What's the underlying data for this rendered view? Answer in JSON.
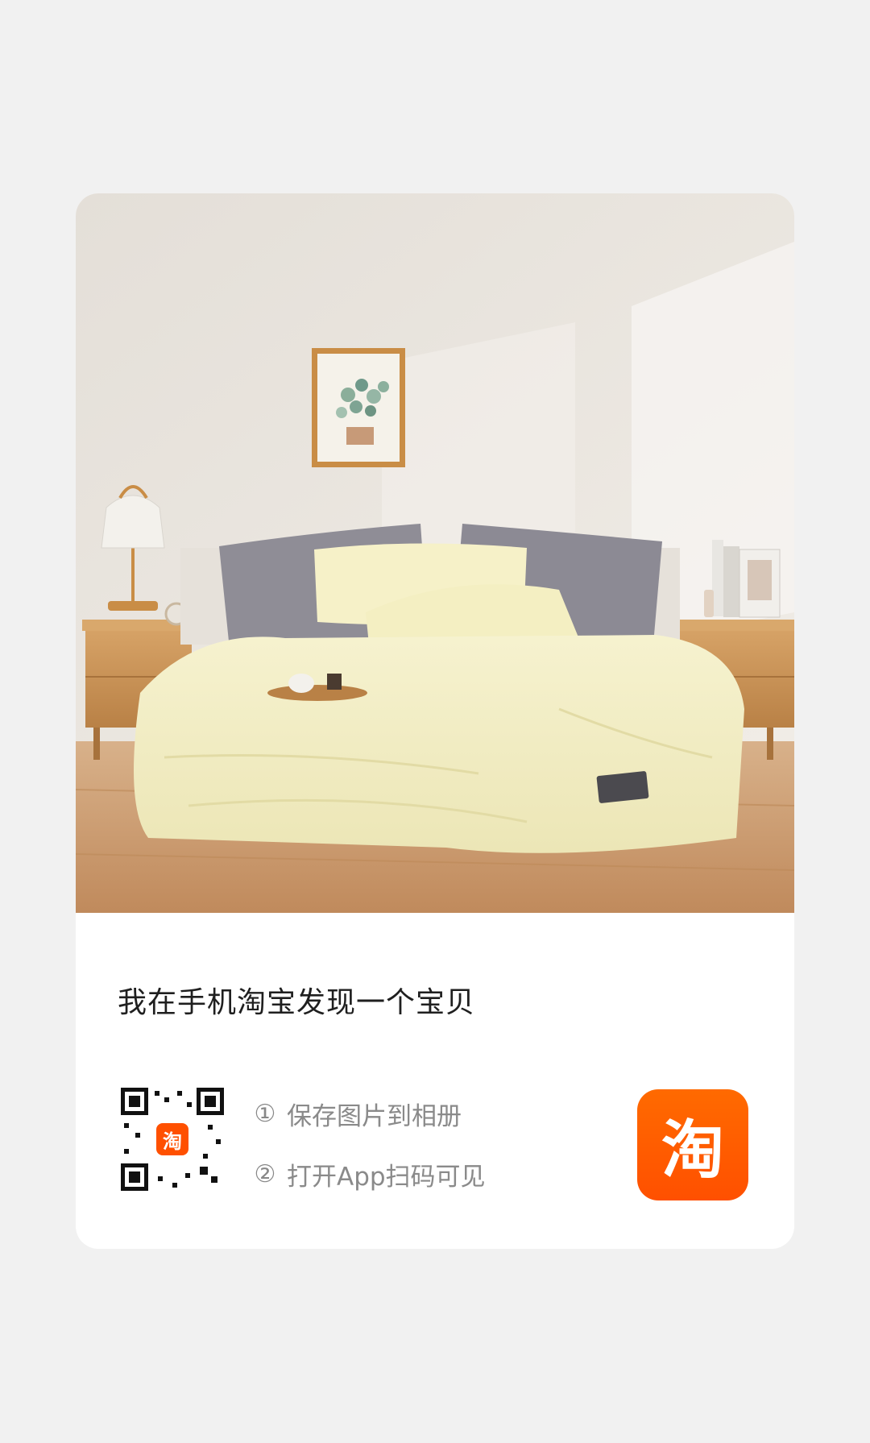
{
  "share_card": {
    "message": "我在手机淘宝发现一个宝贝",
    "qr_badge": "淘",
    "steps": [
      {
        "num": "①",
        "text": "保存图片到相册"
      },
      {
        "num": "②",
        "text": "打开App扫码可见"
      }
    ],
    "app_icon_glyph": "淘"
  },
  "colors": {
    "page_background": "#f1f1f1",
    "card_background": "#ffffff",
    "brand_orange": "#ff5000",
    "duvet": "#f4efc4",
    "pillow_grey": "#8f8d96",
    "wood": "#c9904f",
    "wall": "#ebe7e2",
    "floor": "#c99a6f"
  },
  "icons": [
    "qr-code-icon",
    "taobao-app-icon"
  ]
}
